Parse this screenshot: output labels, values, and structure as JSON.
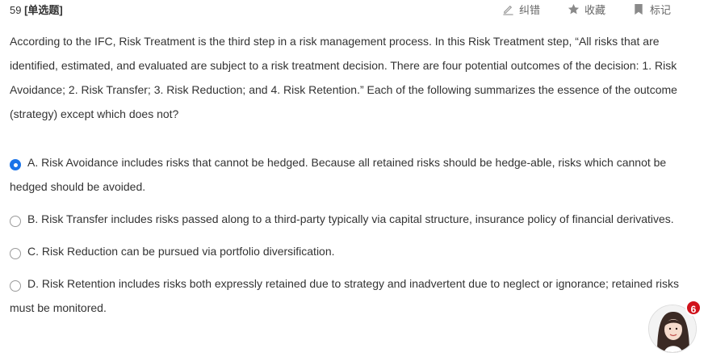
{
  "question": {
    "number": "59",
    "type": "[单选题]",
    "stem": "According to the IFC, Risk Treatment is the third step in a risk management process. In this Risk Treatment step, “All risks that are identified, estimated, and evaluated are subject to a risk treatment decision. There are four potential outcomes of the decision: 1. Risk Avoidance; 2. Risk Transfer; 3. Risk Reduction; and 4. Risk Retention.” Each of the following summarizes the essence of the outcome (strategy) except which does not?",
    "selected": "A"
  },
  "toolbar": {
    "correct_label": "纠错",
    "favorite_label": "收藏",
    "mark_label": "标记",
    "correct_icon": "pencil-icon",
    "favorite_icon": "star-icon",
    "mark_icon": "bookmark-icon"
  },
  "options": [
    {
      "text": "A. Risk Avoidance includes risks that cannot be hedged. Because all retained risks should be hedge-able, risks which cannot be hedged should be avoided.",
      "checked": true
    },
    {
      "text": "B. Risk Transfer includes risks passed along to a third-party typically via capital structure, insurance policy of financial derivatives.",
      "checked": false
    },
    {
      "text": "C. Risk Reduction can be pursued via portfolio diversification.",
      "checked": false
    },
    {
      "text": "D. Risk Retention includes risks both expressly retained due to strategy and inadvertent due to neglect or ignorance; retained risks must be monitored.",
      "checked": false
    }
  ],
  "assistant": {
    "badge_count": "6"
  },
  "colors": {
    "accent": "#1a73e8",
    "badge": "#d0121b",
    "icon_gray": "#999999"
  }
}
